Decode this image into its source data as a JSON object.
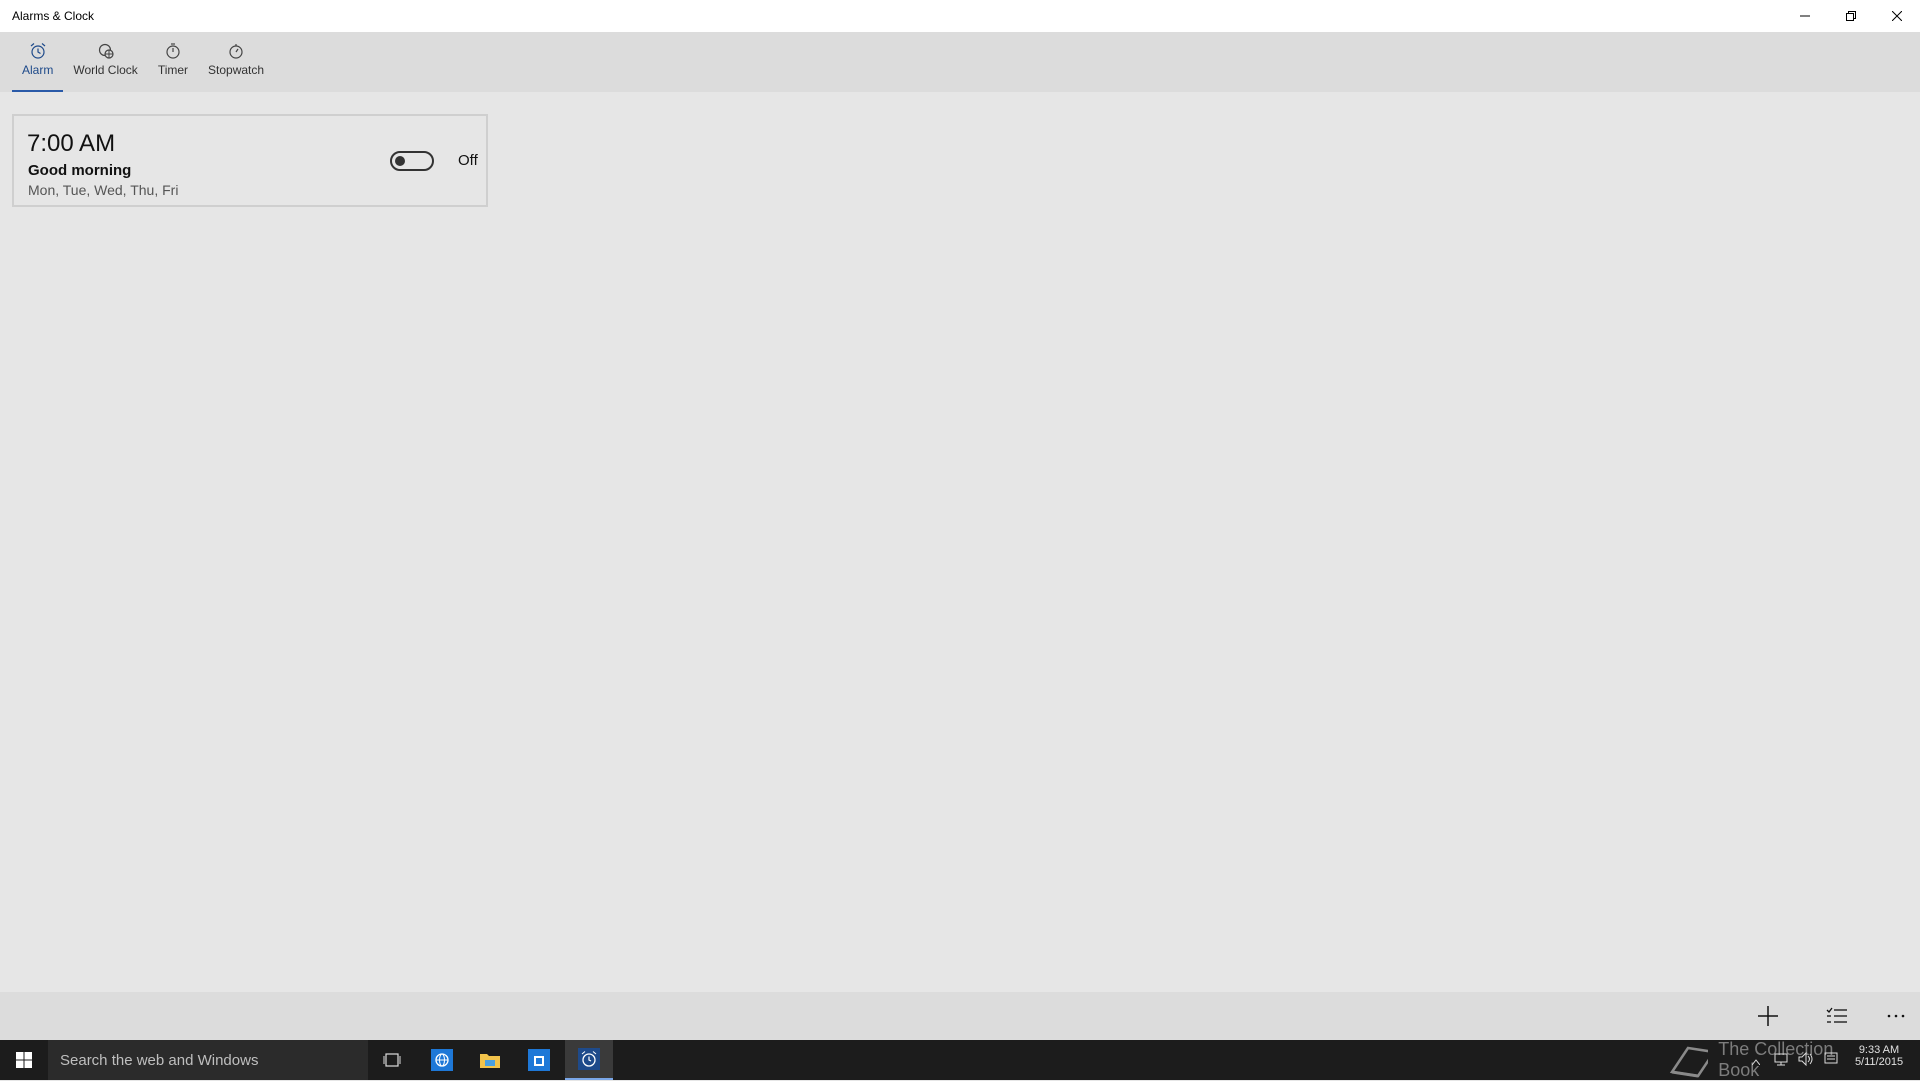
{
  "window": {
    "title": "Alarms & Clock",
    "controls": [
      "minimize-icon",
      "restore-icon",
      "close-icon"
    ]
  },
  "tabs": [
    {
      "label": "Alarm",
      "icon": "alarm-clock-icon",
      "active": true
    },
    {
      "label": "World Clock",
      "icon": "globe-clock-icon",
      "active": false
    },
    {
      "label": "Timer",
      "icon": "timer-icon",
      "active": false
    },
    {
      "label": "Stopwatch",
      "icon": "stopwatch-icon",
      "active": false
    }
  ],
  "alarm": {
    "time": "7:00 AM",
    "name": "Good morning",
    "days": "Mon, Tue, Wed, Thu, Fri",
    "toggle_state": "Off",
    "enabled": false
  },
  "commandbar": {
    "actions": [
      "add-icon",
      "select-list-icon",
      "more-icon"
    ]
  },
  "taskbar": {
    "search_placeholder": "Search the web and Windows",
    "apps": [
      "task-view-icon",
      "edge-icon",
      "file-explorer-icon",
      "store-icon",
      "alarms-icon"
    ],
    "clock_time": "9:33 AM",
    "clock_date": "5/11/2015",
    "watermark": "The Collection Book"
  },
  "colors": {
    "accent": "#2a5aa8",
    "background": "#e6e6e6",
    "taskbar": "#1c1c1c"
  }
}
